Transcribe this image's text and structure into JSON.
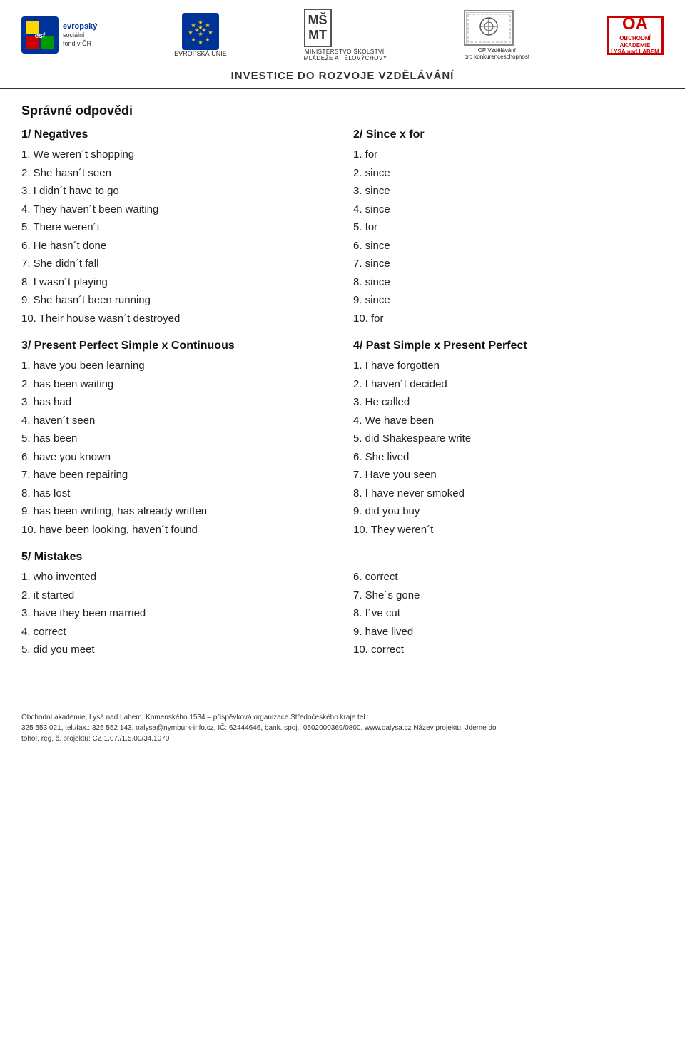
{
  "header": {
    "esf_label": "esf",
    "esf_subtitle": "evropský\nsociální\nfond v ČR",
    "eu_label": "★★★\n★ ★\n★★★",
    "eu_subtitle": "EVROPSKÁ UNIE",
    "msmt_line1": "MŠ",
    "msmt_line2": "MT",
    "msmt_subtitle": "MINISTERSTVO ŠKOLSTVÍ,\nMLÁDEŽE A TĚLOVÝCHOVY",
    "op_label": "OP Vzdělávání\npro\nkonkurenceschopnost",
    "lysa_num": "OA",
    "lysa_subtitle": "OBCHODNÍ\nAKADEMIE\nLYSÁ nad LABEM",
    "invest_title": "INVESTICE DO ROZVOJE VZDĚLÁVÁNÍ"
  },
  "page_title": "Správné odpovědi",
  "section1": {
    "title": "1/ Negatives",
    "items": [
      "1. We weren´t shopping",
      "2. She hasn´t seen",
      "3. I didn´t have to go",
      "4. They haven´t been waiting",
      "5. There weren´t",
      "6. He hasn´t done",
      "7. She didn´t fall",
      "8. I wasn´t playing",
      "9. She hasn´t been running",
      "10. Their house wasn´t destroyed"
    ]
  },
  "section2": {
    "title": "2/ Since x for",
    "items": [
      "1. for",
      "2. since",
      "3. since",
      "4. since",
      "5. for",
      "6. since",
      "7. since",
      "8. since",
      "9. since",
      "10. for"
    ]
  },
  "section3": {
    "title": "3/ Present Perfect Simple x Continuous",
    "items": [
      "1. have you been learning",
      "2. has been waiting",
      "3. has had",
      "4. haven´t seen",
      "5. has been",
      "6. have you known",
      "7. have been repairing",
      "8. has lost",
      "9. has been writing, has already written",
      "10. have been looking, haven´t found"
    ]
  },
  "section4": {
    "title": "4/ Past Simple x Present Perfect",
    "items": [
      "1. I have forgotten",
      "2. I haven´t decided",
      "3. He called",
      "4. We have been",
      "5. did Shakespeare write",
      "6. She lived",
      "7. Have you seen",
      "8. I have never smoked",
      "9. did you buy",
      "10. They weren´t"
    ]
  },
  "section5": {
    "title": "5/ Mistakes",
    "left_items": [
      "1. who invented",
      "2. it started",
      "3. have they been married",
      "4. correct",
      "5. did you meet"
    ],
    "right_items": [
      "6. correct",
      "7. She´s gone",
      "8. I´ve cut",
      "9. have lived",
      "10. correct"
    ]
  },
  "footer": {
    "line1": "Obchodní akademie, Lysá nad Labem, Komenského 1534 – příspěvková organizace Středočeského kraje tel.:",
    "line2": "325 553 021, tel./fax.: 325 552 143, oalysa@nymburk-info.cz, IČ: 62444646, bank. spoj.: 0502000369/0800, www.oalysa.cz Název projektu: Jdeme do",
    "line3": "toho!, reg. č. projektu: CZ.1.07./1.5.00/34.1070"
  }
}
